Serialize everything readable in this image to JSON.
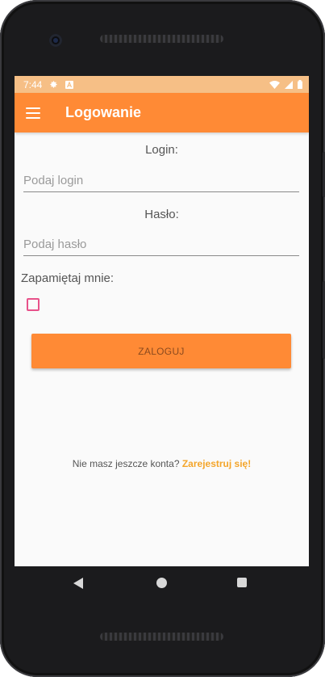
{
  "status_bar": {
    "time": "7:44",
    "icons": [
      "settings-icon",
      "a-notification-icon",
      "wifi-icon",
      "signal-icon",
      "battery-icon"
    ]
  },
  "toolbar": {
    "title": "Logowanie",
    "menu_icon": "hamburger-menu-icon"
  },
  "form": {
    "login_label": "Login:",
    "login_placeholder": "Podaj login",
    "login_value": "",
    "password_label": "Hasło:",
    "password_placeholder": "Podaj hasło",
    "password_value": "",
    "remember_label": "Zapamiętaj mnie:",
    "remember_checked": false,
    "login_button": "ZALOGUJ"
  },
  "register": {
    "prompt": "Nie masz jeszcze konta?",
    "link": "Zarejestruj się!"
  },
  "nav_bar": {
    "icons": [
      "back-icon",
      "home-icon",
      "recents-icon"
    ]
  },
  "colors": {
    "primary": "#ff8a35",
    "status_bar": "#f6bf86",
    "accent_link": "#f4a52a",
    "checkbox": "#e8528a"
  }
}
